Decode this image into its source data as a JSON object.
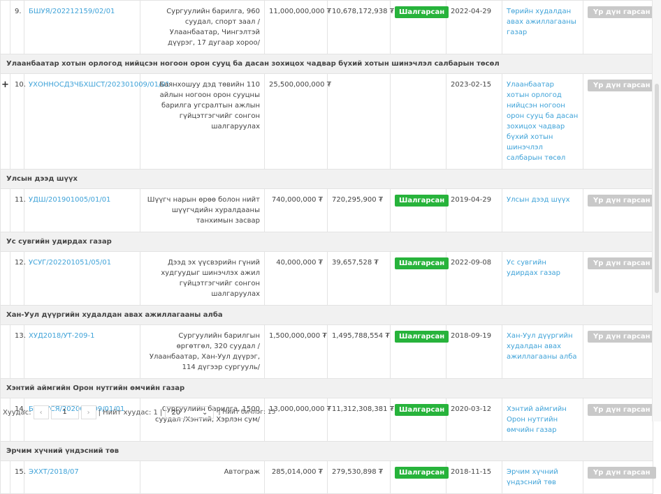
{
  "groups": [
    {
      "group_title": "",
      "row": {
        "expander": "",
        "num": "9.",
        "code": "БШУЯ/202212159/02/01",
        "description": "Сургуулийн барилга, 960 суудал, спорт заал /Улаанбаатар, Чингэлтэй дүүрэг, 17 дугаар хороо/",
        "budget": "11,000,000,000 ₮",
        "contract": "10,678,172,938 ₮",
        "status": "Шалгарсан",
        "date": "2022-04-29",
        "organization": "Төрийн худалдан авах ажиллагааны газар",
        "action": "Үр дүн гарсан"
      }
    },
    {
      "group_title": "Улаанбаатар хотын орлогод нийцсэн ногоон орон сууц ба дасан зохицох чадвар бүхий хотын шинэчлэл салбарын төсөл",
      "row": {
        "expander": "+",
        "num": "10.",
        "code": "УХОННОСДЗЧБХШСТ/202301009/01/01",
        "description": "Баянхошуу дэд төвийн 110 айлын ногоон орон сууцны барилга угсралтын ажлын гүйцэтгэгчийг сонгон шалгаруулах",
        "budget": "25,500,000,000 ₮",
        "contract": "",
        "status": "",
        "date": "2023-02-15",
        "organization": "Улаанбаатар хотын орлогод нийцсэн ногоон орон сууц ба дасан зохицох чадвар бүхий хотын шинэчлэл салбарын төсөл",
        "action": "Үр дүн гарсан"
      }
    },
    {
      "group_title": "Улсын дээд шүүх",
      "row": {
        "expander": "",
        "num": "11.",
        "code": "УДШ/201901005/01/01",
        "description": "Шүүгч нарын өрөө болон нийт шүүгчдийн хуралдааны танхимын засвар",
        "budget": "740,000,000 ₮",
        "contract": "720,295,900 ₮",
        "status": "Шалгарсан",
        "date": "2019-04-29",
        "organization": "Улсын дээд шүүх",
        "action": "Үр дүн гарсан"
      }
    },
    {
      "group_title": "Ус сувгийн удирдах газар",
      "row": {
        "expander": "",
        "num": "12.",
        "code": "УСУГ/202201051/05/01",
        "description": "Дээд эх үүсвэрийн гүний худгуудыг шинэчлэх ажил гүйцэтгэгчийг сонгон шалгаруулах",
        "budget": "40,000,000 ₮",
        "contract": "39,657,528 ₮",
        "status": "Шалгарсан",
        "date": "2022-09-08",
        "organization": "Ус сувгийн удирдах газар",
        "action": "Үр дүн гарсан"
      }
    },
    {
      "group_title": "Хан-Уул дүүргийн худалдан авах ажиллагааны алба",
      "row": {
        "expander": "",
        "num": "13.",
        "code": "ХУД2018/УТ-209-1",
        "description": "Сургуулийн барилгын өргөтгөл, 320 суудал /Улаанбаатар, Хан-Уул дүүрэг, 114 дүгээр сургууль/",
        "budget": "1,500,000,000 ₮",
        "contract": "1,495,788,554 ₮",
        "status": "Шалгарсан",
        "date": "2018-09-19",
        "organization": "Хан-Уул дүүргийн худалдан авах ажиллагааны алба",
        "action": "Үр дүн гарсан"
      }
    },
    {
      "group_title": "Хэнтий аймгийн Орон нутгийн өмчийн газар",
      "row": {
        "expander": "",
        "num": "14.",
        "code": "БСШУСЯ/202001209/01/01",
        "description": "Сургуулийн барилга, 1500 суудал /Хэнтий, Хэрлэн сум/",
        "budget": "13,000,000,000 ₮",
        "contract": "11,312,308,381 ₮",
        "status": "Шалгарсан",
        "date": "2020-03-12",
        "organization": "Хэнтий аймгийн Орон нутгийн өмчийн газар",
        "action": "Үр дүн гарсан"
      }
    },
    {
      "group_title": "Эрчим хүчний үндэсний төв",
      "row": {
        "expander": "",
        "num": "15.",
        "code": "ЭХХТ/2018/07",
        "description": "Автограж",
        "budget": "285,014,000 ₮",
        "contract": "279,530,898 ₮",
        "status": "Шалгарсан",
        "date": "2018-11-15",
        "organization": "Эрчим хүчний үндэсний төв",
        "action": "Үр дүн гарсан"
      }
    }
  ],
  "pagination": {
    "page_label": "Хуудас:",
    "prev_icon": "‹",
    "current_page": "1",
    "next_icon": "›",
    "total_pages_label": "| Нийт хуудас: 1 |",
    "page_size": "20",
    "dropdown_icon": "⌄",
    "total_records_label": "| Нийт бичлэг: 15"
  }
}
